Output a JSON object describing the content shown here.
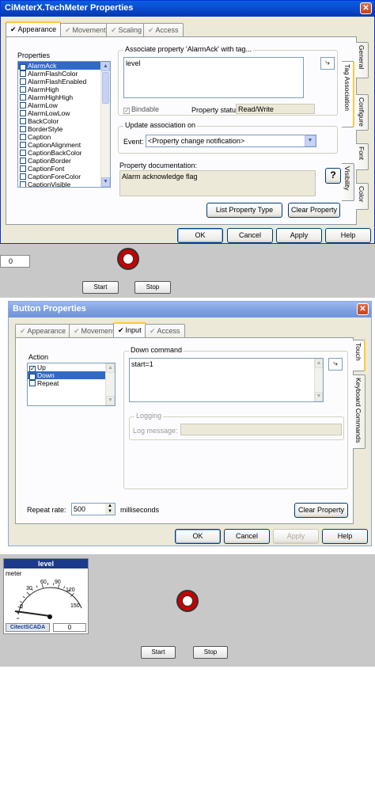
{
  "dialog1": {
    "title": "CiMeterX.TechMeter Properties",
    "tabs": [
      "Appearance",
      "Movement",
      "Scaling",
      "Access"
    ],
    "properties_label": "Properties",
    "properties": [
      {
        "name": "AlarmAck",
        "checked": true,
        "selected": true
      },
      {
        "name": "AlarmFlashColor",
        "checked": false
      },
      {
        "name": "AlarmFlashEnabled",
        "checked": false
      },
      {
        "name": "AlarmHigh",
        "checked": false
      },
      {
        "name": "AlarmHighHigh",
        "checked": false
      },
      {
        "name": "AlarmLow",
        "checked": false
      },
      {
        "name": "AlarmLowLow",
        "checked": false
      },
      {
        "name": "BackColor",
        "checked": false
      },
      {
        "name": "BorderStyle",
        "checked": false
      },
      {
        "name": "Caption",
        "checked": false
      },
      {
        "name": "CaptionAlignment",
        "checked": false
      },
      {
        "name": "CaptionBackColor",
        "checked": false
      },
      {
        "name": "CaptionBorder",
        "checked": false
      },
      {
        "name": "CaptionFont",
        "checked": false
      },
      {
        "name": "CaptionForeColor",
        "checked": false
      },
      {
        "name": "CaptionVisible",
        "checked": false
      }
    ],
    "associate_label": "Associate property 'AlarmAck' with tag...",
    "tag_value": "level",
    "bindable_label": "Bindable",
    "property_status_label": "Property status:",
    "property_status_value": "Read/Write",
    "update_label": "Update association on",
    "event_label": "Event:",
    "event_value": "<Property change notification>",
    "doc_label": "Property documentation:",
    "doc_value": "Alarm acknowledge flag",
    "help_glyph": "?",
    "list_type_btn": "List Property Type",
    "clear_btn": "Clear Property",
    "side_tabs": [
      "General",
      "Tag Association",
      "Configure",
      "Font",
      "Visibility",
      "Color"
    ],
    "ok": "OK",
    "cancel": "Cancel",
    "apply": "Apply",
    "help": "Help"
  },
  "runtime1": {
    "value": "0",
    "start": "Start",
    "stop": "Stop"
  },
  "dialog2": {
    "title": "Button Properties",
    "tabs": [
      "Appearance",
      "Movement",
      "Input",
      "Access"
    ],
    "action_label": "Action",
    "actions": [
      {
        "name": "Up",
        "checked": true,
        "selected": false
      },
      {
        "name": "Down",
        "checked": true,
        "selected": true
      },
      {
        "name": "Repeat",
        "checked": false,
        "selected": false
      }
    ],
    "down_command_label": "Down command",
    "down_command_value": "start=1",
    "logging_label": "Logging",
    "log_message_label": "Log message:",
    "repeat_rate_label": "Repeat rate:",
    "repeat_rate_value": "500",
    "milliseconds_label": "milliseconds",
    "clear_btn": "Clear Property",
    "side_tabs": [
      "Touch",
      "Keyboard Commands"
    ],
    "ok": "OK",
    "cancel": "Cancel",
    "apply": "Apply",
    "help": "Help"
  },
  "runtime2": {
    "meter_title": "level",
    "meter_label": "meter",
    "ticks": [
      "0",
      "30",
      "60",
      "90",
      "120",
      "150"
    ],
    "brand": "CitectSCADA",
    "value": "0",
    "start": "Start",
    "stop": "Stop"
  },
  "colors": {
    "xp_blue": "#0a46c8",
    "dialog_bg": "#ece9d8",
    "selection": "#316ac5",
    "indicator_red": "#c80000"
  }
}
